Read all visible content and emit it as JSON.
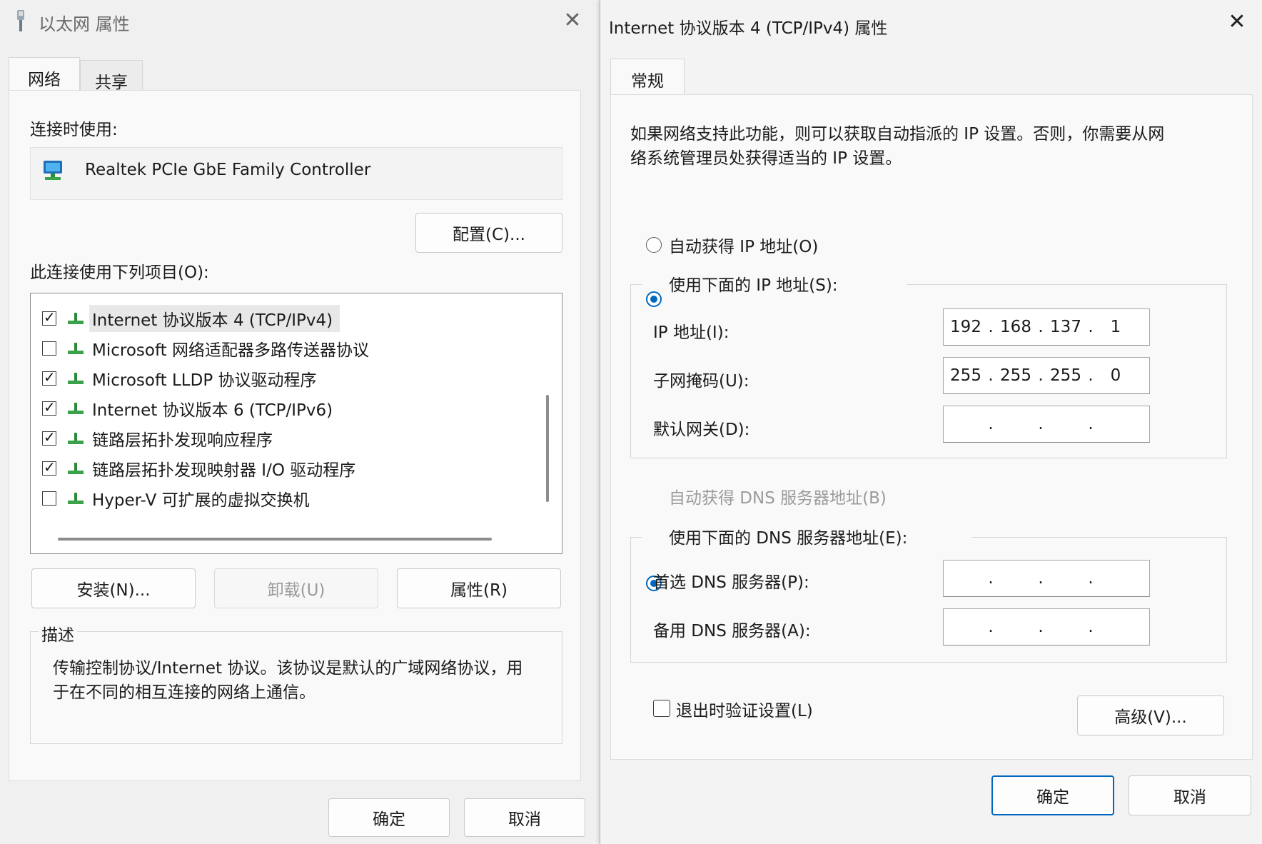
{
  "left_dialog": {
    "title": "以太网 属性",
    "tabs": [
      {
        "label": "网络",
        "active": true
      },
      {
        "label": "共享",
        "active": false
      }
    ],
    "connect_using_label": "连接时使用:",
    "adapter_name": "Realtek PCIe GbE Family Controller",
    "configure_button": "配置(C)...",
    "items_label": "此连接使用下列项目(O):",
    "items": [
      {
        "label": "Internet 协议版本 4 (TCP/IPv4)",
        "checked": true,
        "selected": true
      },
      {
        "label": "Microsoft 网络适配器多路传送器协议",
        "checked": false,
        "selected": false
      },
      {
        "label": "Microsoft LLDP 协议驱动程序",
        "checked": true,
        "selected": false
      },
      {
        "label": "Internet 协议版本 6 (TCP/IPv6)",
        "checked": true,
        "selected": false
      },
      {
        "label": "链路层拓扑发现响应程序",
        "checked": true,
        "selected": false
      },
      {
        "label": "链路层拓扑发现映射器 I/O 驱动程序",
        "checked": true,
        "selected": false
      },
      {
        "label": "Hyper-V 可扩展的虚拟交换机",
        "checked": false,
        "selected": false
      }
    ],
    "install_button": "安装(N)...",
    "uninstall_button": "卸载(U)",
    "properties_button": "属性(R)",
    "description_title": "描述",
    "description_text_line1": "传输控制协议/Internet 协议。该协议是默认的广域网络协议，用",
    "description_text_line2": "于在不同的相互连接的网络上通信。",
    "ok_button": "确定",
    "cancel_button": "取消"
  },
  "right_dialog": {
    "title": "Internet 协议版本 4 (TCP/IPv4) 属性",
    "tab_general": "常规",
    "intro_line1": "如果网络支持此功能，则可以获取自动指派的 IP 设置。否则，你需要从网",
    "intro_line2": "络系统管理员处获得适当的 IP 设置。",
    "auto_ip_label": "自动获得 IP 地址(O)",
    "manual_ip_label": "使用下面的 IP 地址(S):",
    "ip_address_label": "IP 地址(I):",
    "ip_address": [
      "192",
      "168",
      "137",
      "1"
    ],
    "subnet_label": "子网掩码(U):",
    "subnet": [
      "255",
      "255",
      "255",
      "0"
    ],
    "gateway_label": "默认网关(D):",
    "gateway": [
      "",
      "",
      "",
      ""
    ],
    "auto_dns_label": "自动获得 DNS 服务器地址(B)",
    "manual_dns_label": "使用下面的 DNS 服务器地址(E):",
    "preferred_dns_label": "首选 DNS 服务器(P):",
    "preferred_dns": [
      "",
      "",
      "",
      ""
    ],
    "alternate_dns_label": "备用 DNS 服务器(A):",
    "alternate_dns": [
      "",
      "",
      "",
      ""
    ],
    "validate_label": "退出时验证设置(L)",
    "validate_checked": false,
    "advanced_button": "高级(V)...",
    "ok_button": "确定",
    "cancel_button": "取消"
  },
  "colors": {
    "accent": "#0067c0",
    "window_bg": "#f3f3f3",
    "panel_bg": "#f9f9f9"
  }
}
